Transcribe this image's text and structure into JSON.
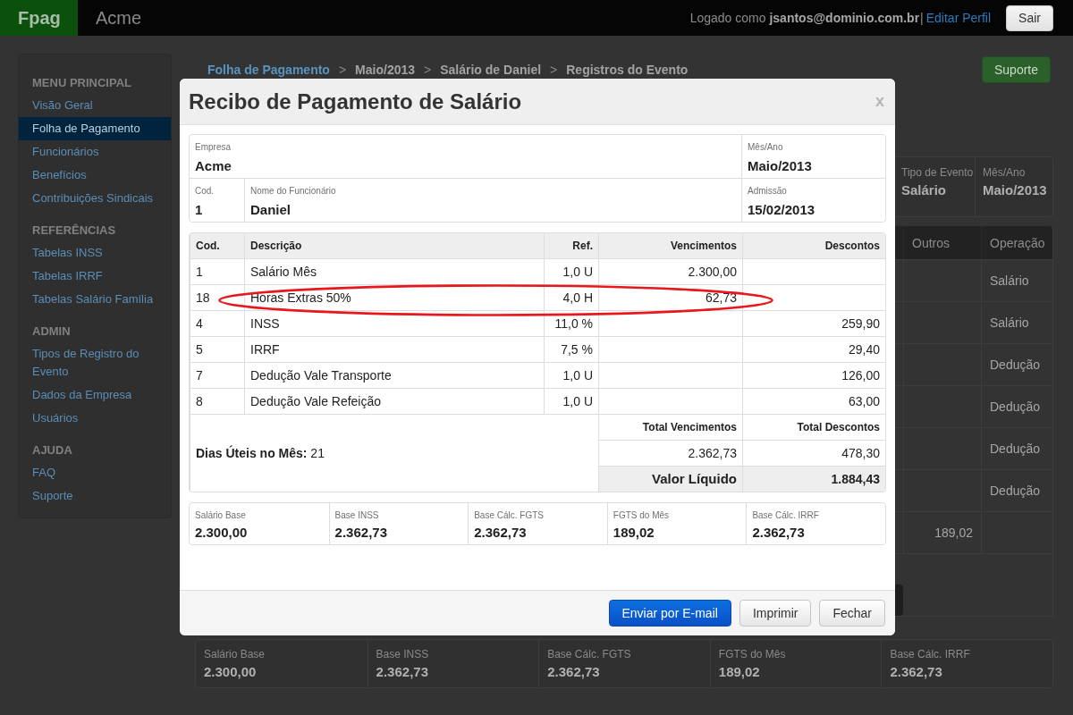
{
  "topbar": {
    "brand": "Fpag",
    "app_name": "Acme",
    "user_text": "Logado como **jsantos@dominio.com.br**",
    "separator": "|",
    "profile_link": "Editar Perfil",
    "logout_button": "Sair"
  },
  "sidebar": {
    "sections": [
      {
        "title": "MENU PRINCIPAL",
        "items": [
          {
            "label": "Visão Geral",
            "selected": false
          },
          {
            "label": "Folha de Pagamento",
            "selected": true
          },
          {
            "label": "Funcionários",
            "selected": false
          },
          {
            "label": "Benefícios",
            "selected": false
          },
          {
            "label": "Contribuições Sindicais",
            "selected": false
          }
        ]
      },
      {
        "title": "REFERÊNCIAS",
        "items": [
          {
            "label": "Tabelas INSS",
            "selected": false
          },
          {
            "label": "Tabelas IRRF",
            "selected": false
          },
          {
            "label": "Tabelas Salário Família",
            "selected": false
          }
        ]
      },
      {
        "title": "ADMIN",
        "items": [
          {
            "label": "Tipos de Registro do Evento",
            "selected": false
          },
          {
            "label": "Dados da Empresa",
            "selected": false
          },
          {
            "label": "Usuários",
            "selected": false
          }
        ]
      },
      {
        "title": "AJUDA",
        "items": [
          {
            "label": "FAQ",
            "selected": false
          },
          {
            "label": "Suporte",
            "selected": false
          }
        ]
      }
    ]
  },
  "breadcrumb": [
    {
      "kind": "link",
      "text": "Folha de Pagamento"
    },
    {
      "kind": "separator",
      "text": ">"
    },
    {
      "kind": "text",
      "text": "Maio/2013"
    },
    {
      "kind": "separator",
      "text": ">"
    },
    {
      "kind": "text",
      "text": "Salário de Daniel"
    },
    {
      "kind": "separator",
      "text": ">"
    },
    {
      "kind": "text",
      "text": "Registros do Evento"
    }
  ],
  "support_button": "Suporte",
  "background": {
    "event_info": [
      {
        "label": "Tipo de Evento",
        "value": "Salário"
      },
      {
        "label": "Mês/Ano",
        "value": "Maio/2013"
      }
    ],
    "table": {
      "columns": [
        "Outros",
        "Operação"
      ],
      "rows": [
        {
          "operation": "Salário"
        },
        {
          "operation": "Salário"
        },
        {
          "operation": "Dedução"
        },
        {
          "operation": "Dedução"
        },
        {
          "operation": "Dedução"
        },
        {
          "operation": "Dedução"
        },
        {
          "others": "189,02"
        }
      ]
    },
    "summary": [
      {
        "label": "Salário Base",
        "value": "2.300,00"
      },
      {
        "label": "Base INSS",
        "value": "2.362,73"
      },
      {
        "label": "Base Cálc. FGTS",
        "value": "2.362,73"
      },
      {
        "label": "FGTS do Mês",
        "value": "189,02"
      },
      {
        "label": "Base Cálc. IRRF",
        "value": "2.362,73"
      }
    ]
  },
  "modal": {
    "title": "Recibo de Pagamento de Salário",
    "close": "x",
    "header_fields": {
      "company": {
        "label": "Empresa",
        "value": "Acme"
      },
      "period": {
        "label": "Mês/Ano",
        "value": "Maio/2013"
      },
      "code": {
        "label": "Cod.",
        "value": "1"
      },
      "employee": {
        "label": "Nome do Funcionário",
        "value": "Daniel"
      },
      "admission": {
        "label": "Admissão",
        "value": "15/02/2013"
      }
    },
    "table": {
      "columns": [
        "Cod.",
        "Descrição",
        "Ref.",
        "Vencimentos",
        "Descontos"
      ],
      "rows": [
        {
          "code": "1",
          "description": "Salário Mês",
          "ref": "1,0 U",
          "earnings": "2.300,00",
          "highlighted": false
        },
        {
          "code": "18",
          "description": "Horas Extras 50%",
          "ref": "4,0 H",
          "earnings": "62,73",
          "highlighted": true
        },
        {
          "code": "4",
          "description": "INSS",
          "ref": "11,0 %",
          "deductions": "259,90",
          "highlighted": false
        },
        {
          "code": "5",
          "description": "IRRF",
          "ref": "7,5 %",
          "deductions": "29,40",
          "highlighted": false
        },
        {
          "code": "7",
          "description": "Dedução Vale Transporte",
          "ref": "1,0 U",
          "deductions": "126,00",
          "highlighted": false
        },
        {
          "code": "8",
          "description": "Dedução Vale Refeição",
          "ref": "1,0 U",
          "deductions": "63,00",
          "highlighted": false
        }
      ]
    },
    "totals": {
      "working_days": "**Dias Úteis no Mês:** 21",
      "earnings_label": "Total Vencimentos",
      "deductions_label": "Total Descontos",
      "earnings": "2.362,73",
      "deductions": "478,30",
      "net_label": "Valor Líquido",
      "net_value": "1.884,43"
    },
    "bases": [
      {
        "label": "Salário Base",
        "value": "2.300,00"
      },
      {
        "label": "Base INSS",
        "value": "2.362,73"
      },
      {
        "label": "Base Cálc. FGTS",
        "value": "2.362,73"
      },
      {
        "label": "FGTS do Mês",
        "value": "189,02"
      },
      {
        "label": "Base Cálc. IRRF",
        "value": "2.362,73"
      }
    ],
    "buttons": [
      {
        "label": "Enviar por E-mail",
        "kind": "primary"
      },
      {
        "label": "Imprimir",
        "kind": "default"
      },
      {
        "label": "Fechar",
        "kind": "default"
      }
    ]
  }
}
